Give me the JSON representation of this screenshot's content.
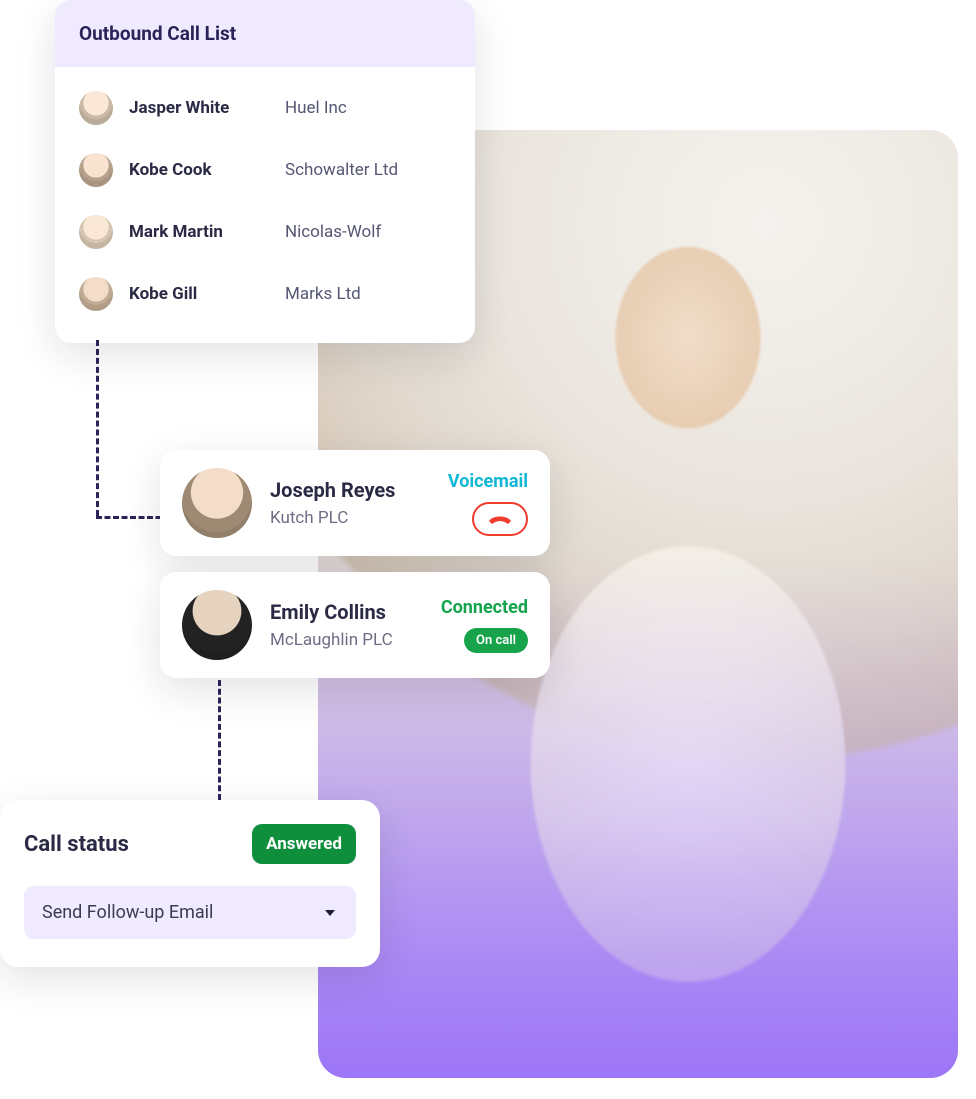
{
  "outbound": {
    "title": "Outbound Call List",
    "items": [
      {
        "name": "Jasper White",
        "company": "Huel Inc"
      },
      {
        "name": "Kobe Cook",
        "company": "Schowalter Ltd"
      },
      {
        "name": "Mark Martin",
        "company": "Nicolas-Wolf"
      },
      {
        "name": "Kobe Gill",
        "company": "Marks Ltd"
      }
    ]
  },
  "calls": [
    {
      "name": "Joseph Reyes",
      "company": "Kutch PLC",
      "status_label": "Voicemail",
      "action_icon": "phone-hangup-icon"
    },
    {
      "name": "Emily Collins",
      "company": "McLaughlin PLC",
      "status_label": "Connected",
      "badge": "On call"
    }
  ],
  "status": {
    "title": "Call status",
    "badge": "Answered",
    "action_label": "Send Follow-up Email"
  },
  "colors": {
    "header_bg": "#efeafd",
    "accent_purple": "#8b5cf6",
    "voicemail": "#0fb7d6",
    "connected": "#14a44d",
    "answered_bg": "#0f8f3c",
    "hangup_red": "#ef3b2d"
  }
}
